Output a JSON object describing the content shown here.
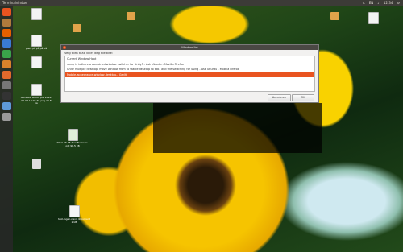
{
  "top_panel": {
    "title": "Terminalvindue",
    "indicators": [
      "⇅",
      "EN",
      "♪",
      "12:34",
      "⚙"
    ]
  },
  "launcher": {
    "icons": [
      {
        "name": "ubuntu-icon",
        "color": "#e95420"
      },
      {
        "name": "files-icon",
        "color": "#b07a3c"
      },
      {
        "name": "firefox-icon",
        "color": "#e66000"
      },
      {
        "name": "writer-icon",
        "color": "#3a7bd5"
      },
      {
        "name": "calc-icon",
        "color": "#3aa34a"
      },
      {
        "name": "impress-icon",
        "color": "#d9822b"
      },
      {
        "name": "software-center-icon",
        "color": "#e26a2c"
      },
      {
        "name": "settings-icon",
        "color": "#777777"
      },
      {
        "name": "terminal-icon",
        "color": "#333333"
      },
      {
        "name": "workspace-icon",
        "color": "#5e9ad6"
      },
      {
        "name": "trash-icon",
        "color": "#9a9a9a"
      }
    ]
  },
  "desktop_icons": [
    {
      "label": "",
      "kind": "doc"
    },
    {
      "label": "plats på på på på",
      "kind": "doc"
    },
    {
      "label": "",
      "kind": "doc"
    },
    {
      "label": "Software Mattie pla 2014-06-02 18:06:45 png 42.8 ka",
      "kind": "doc"
    },
    {
      "label": "2014-06-15 Mon Nemesis-odt 96.5 kB",
      "kind": "doc"
    },
    {
      "label": "",
      "kind": "pkg"
    },
    {
      "label": "test-ingen-navn dokument 2 kB",
      "kind": "doc"
    },
    {
      "label": "",
      "kind": "folder"
    },
    {
      "label": "",
      "kind": "folder"
    },
    {
      "label": "",
      "kind": "folder"
    },
    {
      "label": "",
      "kind": "doc"
    }
  ],
  "dialog": {
    "title": "Window list",
    "prompt": "Velg tilen ti ab velet deg tile tilte:",
    "items": [
      "Current Window Hoot",
      "somy is is there a combined window switcher for Unity? - Ask Ubuntu - Mozilla Firefox",
      "Unity Multiple desktop: move window from to stable desktop to tab? and the switching for using - Ask Ubuntu - Mozilla Firefox",
      "Mobile-appearance-window-desktop-- Gedit",
      ""
    ],
    "selected_index": 3,
    "cancel_label": "Annuleren",
    "ok_label": "OK"
  }
}
